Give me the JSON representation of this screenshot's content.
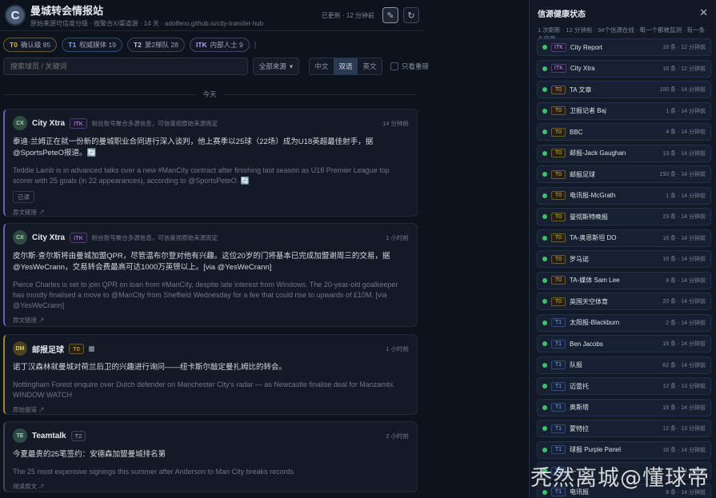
{
  "header": {
    "logo_letter": "C",
    "title": "曼城转会情报站",
    "subtitle": "原始来源可信度分级 · 按聚合X/渠道源 · 14 天 · adolfeno.github.io/city-transfer-hub",
    "updated": "已更新 · 12 分钟前"
  },
  "filters": {
    "chips": [
      {
        "tier": "T0",
        "label": "确认级 85"
      },
      {
        "tier": "T1",
        "label": "权威媒体 19"
      },
      {
        "tier": "T2",
        "label": "第2梯队 28"
      },
      {
        "tier": "ITK",
        "label": "内部人士 9"
      }
    ],
    "search_placeholder": "搜索球员 / 关键词",
    "source_select": "全部来源",
    "lang_options": [
      "中文",
      "双语",
      "英文"
    ],
    "lang_selected": "双语",
    "only_unread": "只看重磅"
  },
  "feed": {
    "date_label": "今天",
    "items": [
      {
        "avatar": "CX",
        "source": "City Xtra",
        "tier": "ITK",
        "note": "粉丝账号聚合多源信息，可信度视原始来源而定",
        "time": "14 分钟前",
        "zh": "泰迪·兰姆正在就一份新的曼城职业合同进行深入谈判，他上赛季以25球（22场）成为U18英超最佳射手，据@SportsPeteO报道。🔄",
        "en": "Teddie Lamb is in advanced talks over a new #ManCity contract after finishing last season as U18 Premier League top scorer with 25 goals (in 22 appearances), according to @SportsPeteO. 🔄",
        "tag": "已读",
        "orig": "原文链接 ↗"
      },
      {
        "avatar": "CX",
        "source": "City Xtra",
        "tier": "ITK",
        "note": "粉丝账号聚合多源信息，可信度视原始来源而定",
        "time": "1 小时前",
        "zh": "皮尔斯·查尔斯将由曼城加盟QPR，尽管温布尔登对他有兴趣。这位20岁的门将基本已完成加盟谢周三的交易，据@YesWeCrann，交易转会费最高可达1000万英镑以上。[via @YesWeCrann]",
        "en": "Pierce Charles is set to join QPR on loan from #ManCity, despite late interest from Windows. The 20-year-old goalkeeper has mostly finalised a move to @ManCity from Sheffield Wednesday for a fee that could rise to upwards of £10M. [via @YesWeCrann]",
        "orig": "原文链接 ↗"
      },
      {
        "avatar": "DM",
        "source": "邮报足球",
        "tier": "T0",
        "time": "1 小时前",
        "zh": "诺丁汉森林就曼城对荷兰后卫的兴趣进行询问——纽卡斯尔敲定曼扎姆比的转会。",
        "en": "Nottingham Forest enquire over Dutch defender on Manchester City's radar — as Newcastle finalise deal for Manzambi. WINDOW WATCH",
        "orig": "原始报道 ↗"
      },
      {
        "avatar": "TE",
        "source": "Teamtalk",
        "tier": "T2",
        "time": "2 小时前",
        "zh": "今夏最贵的25笔签约：安德森加盟曼城排名第",
        "en": "The 25 most expensive signings this summer after Anderson to Man City breaks records",
        "orig": "阅读原文 ↗"
      }
    ]
  },
  "panel": {
    "title": "信源健康状态",
    "subtitle": "1 次刷新 · 12 分钟前 · 34个信源在线 · 每一个都被监测 · 有一条未启用",
    "rows": [
      {
        "tier": "ITK",
        "name": "City Report",
        "stat": "16 条 · 12 分钟前"
      },
      {
        "tier": "ITK",
        "name": "City Xtra",
        "stat": "16 条 · 12 分钟前"
      },
      {
        "tier": "T0",
        "name": "TA 文章",
        "stat": "100 条 · 14 分钟前"
      },
      {
        "tier": "T0",
        "name": "卫报记者 Baj",
        "stat": "1 条 · 14 分钟前"
      },
      {
        "tier": "T0",
        "name": "BBC",
        "stat": "4 条 · 14 分钟前"
      },
      {
        "tier": "T0",
        "name": "邮报-Jack Gaughan",
        "stat": "13 条 · 14 分钟前"
      },
      {
        "tier": "T0",
        "name": "邮报足球",
        "stat": "150 条 · 14 分钟前"
      },
      {
        "tier": "T0",
        "name": "电讯报-McGrath",
        "stat": "1 条 · 14 分钟前"
      },
      {
        "tier": "T0",
        "name": "曼彻斯特晚报",
        "stat": "23 条 · 14 分钟前"
      },
      {
        "tier": "T0",
        "name": "TA-奥恩斯坦 DO",
        "stat": "16 条 · 14 分钟前"
      },
      {
        "tier": "T0",
        "name": "罗马诺",
        "stat": "16 条 · 14 分钟前"
      },
      {
        "tier": "T0",
        "name": "TA-媒体 Sam Lee",
        "stat": "8 条 · 14 分钟前"
      },
      {
        "tier": "T0",
        "name": "英国天空体育",
        "stat": "20 条 · 14 分钟前"
      },
      {
        "tier": "T1",
        "name": "太阳报-Blackburn",
        "stat": "2 条 · 14 分钟前"
      },
      {
        "tier": "T1",
        "name": "Ben Jacobs",
        "stat": "16 条 · 14 分钟前"
      },
      {
        "tier": "T1",
        "name": "队报",
        "stat": "62 条 · 14 分钟前"
      },
      {
        "tier": "T1",
        "name": "迈雷托",
        "stat": "12 条 · 13 分钟前"
      },
      {
        "tier": "T1",
        "name": "奥斯塔",
        "stat": "16 条 · 14 分钟前"
      },
      {
        "tier": "T1",
        "name": "蒙特拉",
        "stat": "12 条 · 13 分钟前"
      },
      {
        "tier": "T1",
        "name": "球报 Purple Panel",
        "stat": "16 条 · 14 分钟前"
      },
      {
        "tier": "T1",
        "name": "—",
        "stat": "— · 14 分钟前"
      },
      {
        "tier": "T1",
        "name": "电讯报",
        "stat": "8 条 · 14 分钟前"
      }
    ]
  },
  "watermark": "秃然离城@懂球帝"
}
